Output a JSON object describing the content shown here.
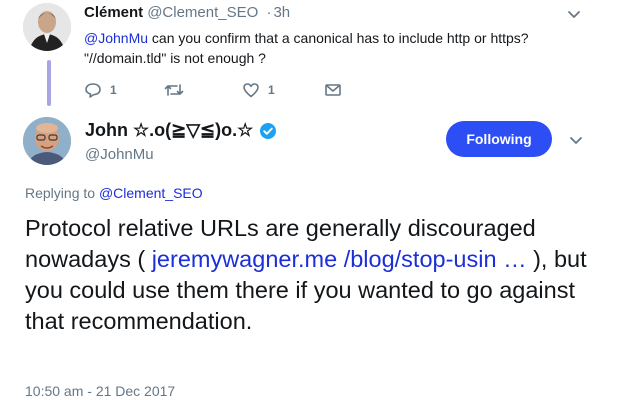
{
  "parent_tweet": {
    "author_name": "Clément",
    "author_handle": "@Clement_SEO",
    "time": "3h",
    "separator": "·",
    "mention": "@JohnMu",
    "text_line1": " can you confirm that a canonical has to include http or https?",
    "text_line2": "\"//domain.tld\" is not enough ?",
    "reply_count": "1",
    "like_count": "1"
  },
  "main_tweet": {
    "author_name": "John ☆.o(≧▽≦)o.☆",
    "author_handle": "@JohnMu",
    "follow_label": "Following",
    "replying_label": "Replying to ",
    "replying_to": "@Clement_SEO",
    "text_part1": "Protocol relative URLs are generally discouraged nowadays ( ",
    "link_text": "jeremywagner.me /blog/stop-usin …",
    "text_part2": " ), but you could use them there if you wanted to go against that recommendation.",
    "timestamp": "10:50 am - 21 Dec 2017"
  },
  "colors": {
    "accent": "#2d4df5",
    "link": "#1b2fd8",
    "thread_line": "#a9a4e6",
    "muted": "#657786",
    "verified": "#1da1f2"
  },
  "icons": [
    "reply-icon",
    "retweet-icon",
    "like-icon",
    "message-icon",
    "chevron-down-icon",
    "verified-icon"
  ]
}
